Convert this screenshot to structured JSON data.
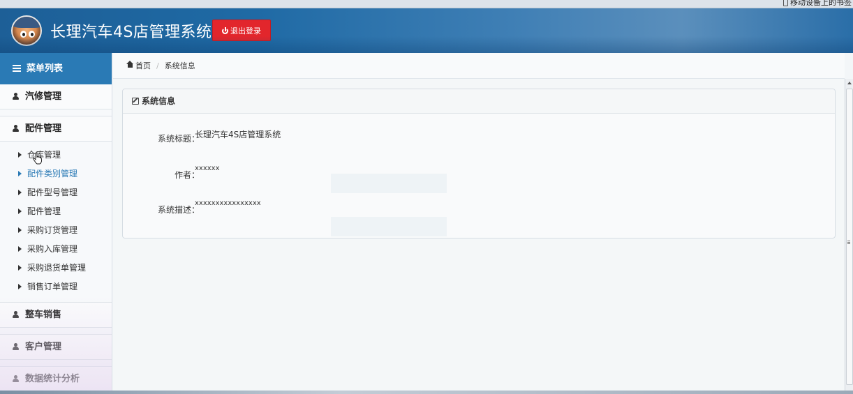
{
  "browser": {
    "mobile_bookmarks": "移动设备上的书签"
  },
  "header": {
    "title": "长理汽车4S店管理系统",
    "logout_label": "退出登录",
    "accent_color": "#1f6aa5",
    "logout_color": "#e2262c"
  },
  "sidebar": {
    "menu_title": "菜单列表",
    "groups": [
      {
        "label": "汽修管理"
      },
      {
        "label": "配件管理"
      },
      {
        "label": "整车销售"
      },
      {
        "label": "客户管理"
      },
      {
        "label": "数据统计分析"
      }
    ],
    "parts_submenu": [
      {
        "label": "仓库管理",
        "active": false
      },
      {
        "label": "配件类别管理",
        "active": true
      },
      {
        "label": "配件型号管理",
        "active": false
      },
      {
        "label": "配件管理",
        "active": false
      },
      {
        "label": "采购订货管理",
        "active": false
      },
      {
        "label": "采购入库管理",
        "active": false
      },
      {
        "label": "采购退货单管理",
        "active": false
      },
      {
        "label": "销售订单管理",
        "active": false
      }
    ]
  },
  "breadcrumb": {
    "home": "首页",
    "current": "系统信息"
  },
  "panel": {
    "title": "系统信息",
    "fields": [
      {
        "label": "系统标题：",
        "value": "长理汽车4S店管理系统"
      },
      {
        "label": "作者：",
        "value": "xxxxxx"
      },
      {
        "label": "系统描述：",
        "value": "xxxxxxxxxxxxxxxx"
      }
    ]
  }
}
